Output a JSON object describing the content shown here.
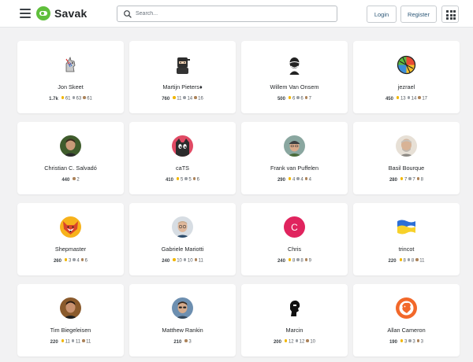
{
  "header": {
    "logo_text": "Savak",
    "search_placeholder": "Search...",
    "login_label": "Login",
    "register_label": "Register"
  },
  "colors": {
    "brand": "#5fbf3b",
    "gold": "#f1b600",
    "silver": "#9a9fa5",
    "bronze": "#ab8259"
  },
  "users": [
    {
      "name": "Jon Skeet",
      "rep": "1.7k",
      "gold": "61",
      "silver": "63",
      "bronze": "61",
      "avatar": "unicorn-avatar"
    },
    {
      "name": "Martijn Pieters♦",
      "rep": "760",
      "gold": "11",
      "silver": "14",
      "bronze": "16",
      "avatar": "ninja-avatar"
    },
    {
      "name": "Willem Van Onsem",
      "rep": "500",
      "gold": "6",
      "silver": "6",
      "bronze": "7",
      "avatar": "bald-man-avatar"
    },
    {
      "name": "jezrael",
      "rep": "450",
      "gold": "13",
      "silver": "14",
      "bronze": "17",
      "avatar": "colorful-ball-avatar"
    },
    {
      "name": "Christian C. Salvadó",
      "rep": "440",
      "gold": "",
      "silver": "",
      "bronze": "2",
      "avatar": "man-photo-avatar"
    },
    {
      "name": "caTS",
      "rep": "410",
      "gold": "5",
      "silver": "5",
      "bronze": "6",
      "avatar": "cat-avatar"
    },
    {
      "name": "Frank van Puffelen",
      "rep": "290",
      "gold": "4",
      "silver": "4",
      "bronze": "4",
      "avatar": "man-cap-avatar"
    },
    {
      "name": "Basil Bourque",
      "rep": "280",
      "gold": "7",
      "silver": "7",
      "bronze": "8",
      "avatar": "older-man-avatar"
    },
    {
      "name": "Shepmaster",
      "rep": "260",
      "gold": "3",
      "silver": "4",
      "bronze": "6",
      "avatar": "fox-avatar"
    },
    {
      "name": "Gabriele Mariotti",
      "rep": "240",
      "gold": "10",
      "silver": "10",
      "bronze": "11",
      "avatar": "man-glasses-avatar"
    },
    {
      "name": "Chris",
      "rep": "240",
      "gold": "8",
      "silver": "8",
      "bronze": "9",
      "avatar": "letter-c-avatar",
      "letter": "C"
    },
    {
      "name": "trincot",
      "rep": "220",
      "gold": "8",
      "silver": "8",
      "bronze": "11",
      "avatar": "ukraine-flag-avatar"
    },
    {
      "name": "Tim Biegeleisen",
      "rep": "220",
      "gold": "11",
      "silver": "11",
      "bronze": "11",
      "avatar": "man-photo-dark-avatar"
    },
    {
      "name": "Matthew Rankin",
      "rep": "210",
      "gold": "",
      "silver": "",
      "bronze": "3",
      "avatar": "man-sunglasses-avatar"
    },
    {
      "name": "Marcin",
      "rep": "200",
      "gold": "12",
      "silver": "12",
      "bronze": "10",
      "avatar": "silhouette-avatar"
    },
    {
      "name": "Allan Cameron",
      "rep": "190",
      "gold": "3",
      "silver": "3",
      "bronze": "3",
      "avatar": "orange-lion-avatar"
    }
  ]
}
